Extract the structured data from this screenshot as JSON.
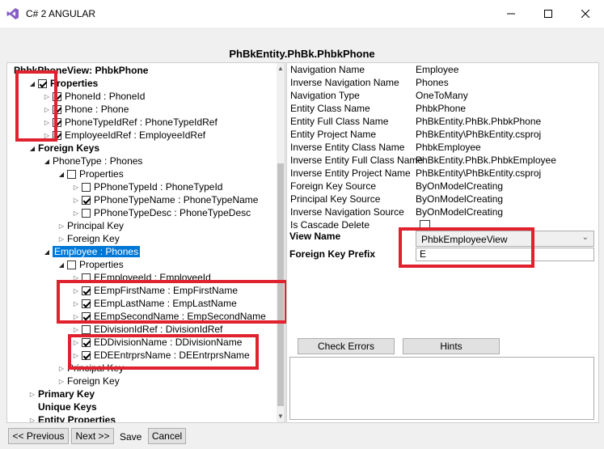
{
  "window": {
    "title": "C# 2 ANGULAR"
  },
  "header": {
    "title": "PhBkEntity.PhBk.PhbkPhone"
  },
  "tree": [
    {
      "label": "PhbkPhoneView: PhbkPhone",
      "bold": true,
      "arrow": "",
      "cb": "",
      "indent": 0
    },
    {
      "label": "Properties",
      "bold": true,
      "arrow": "down",
      "cb": "checked",
      "indent": 1
    },
    {
      "label": "PhoneId : PhoneId",
      "arrow": "right",
      "cb": "checked",
      "indent": 2
    },
    {
      "label": "Phone : Phone",
      "arrow": "right",
      "cb": "checked",
      "indent": 2
    },
    {
      "label": "PhoneTypeIdRef : PhoneTypeIdRef",
      "arrow": "right",
      "cb": "checked",
      "indent": 2
    },
    {
      "label": "EmployeeIdRef : EmployeeIdRef",
      "arrow": "right",
      "cb": "checked",
      "indent": 2
    },
    {
      "label": "Foreign Keys",
      "bold": true,
      "arrow": "down",
      "cb": "",
      "indent": 1
    },
    {
      "label": "PhoneType : Phones",
      "arrow": "down",
      "cb": "",
      "indent": 2
    },
    {
      "label": "Properties",
      "arrow": "down",
      "cb": "unchecked",
      "indent": 3
    },
    {
      "label": "PPhoneTypeId : PhoneTypeId",
      "arrow": "right",
      "cb": "unchecked",
      "indent": 4
    },
    {
      "label": "PPhoneTypeName : PhoneTypeName",
      "arrow": "right",
      "cb": "checked",
      "indent": 4
    },
    {
      "label": "PPhoneTypeDesc : PhoneTypeDesc",
      "arrow": "right",
      "cb": "unchecked",
      "indent": 4
    },
    {
      "label": "Principal Key",
      "arrow": "right",
      "cb": "",
      "indent": 3
    },
    {
      "label": "Foreign Key",
      "arrow": "right",
      "cb": "",
      "indent": 3
    },
    {
      "label": "Employee : Phones",
      "arrow": "down",
      "cb": "",
      "indent": 2,
      "selected": true
    },
    {
      "label": "Properties",
      "arrow": "down",
      "cb": "unchecked",
      "indent": 3
    },
    {
      "label": "EEmployeeId : EmployeeId",
      "arrow": "right",
      "cb": "unchecked",
      "indent": 4
    },
    {
      "label": "EEmpFirstName : EmpFirstName",
      "arrow": "right",
      "cb": "checked",
      "indent": 4
    },
    {
      "label": "EEmpLastName : EmpLastName",
      "arrow": "right",
      "cb": "checked",
      "indent": 4
    },
    {
      "label": "EEmpSecondName : EmpSecondName",
      "arrow": "right",
      "cb": "checked",
      "indent": 4
    },
    {
      "label": "EDivisionIdRef : DivisionIdRef",
      "arrow": "right",
      "cb": "unchecked",
      "indent": 4
    },
    {
      "label": "EDDivisionName : DDivisionName",
      "arrow": "right",
      "cb": "checked",
      "indent": 4
    },
    {
      "label": "EDEEntrprsName : DEEntrprsName",
      "arrow": "right",
      "cb": "checked",
      "indent": 4
    },
    {
      "label": "Principal Key",
      "arrow": "right",
      "cb": "",
      "indent": 3
    },
    {
      "label": "Foreign Key",
      "arrow": "right",
      "cb": "",
      "indent": 3
    },
    {
      "label": "Primary Key",
      "bold": true,
      "arrow": "right",
      "cb": "",
      "indent": 1
    },
    {
      "label": "Unique Keys",
      "bold": true,
      "arrow": "",
      "cb": "",
      "indent": 1
    },
    {
      "label": "Entity Properties",
      "bold": true,
      "arrow": "right",
      "cb": "",
      "indent": 1
    }
  ],
  "properties": [
    {
      "label": "Navigation Name",
      "value": "Employee"
    },
    {
      "label": "Inverse Navigation Name",
      "value": "Phones"
    },
    {
      "label": "Navigation Type",
      "value": "OneToMany"
    },
    {
      "label": "Entity Class Name",
      "value": "PhbkPhone"
    },
    {
      "label": "Entity Full Class Name",
      "value": "PhBkEntity.PhBk.PhbkPhone"
    },
    {
      "label": "Entity Project Name",
      "value": "PhBkEntity\\PhBkEntity.csproj"
    },
    {
      "label": "Inverse Entity Class Name",
      "value": "PhbkEmployee"
    },
    {
      "label": "Inverse Entity Full Class Name",
      "value": "PhBkEntity.PhBk.PhbkEmployee"
    },
    {
      "label": "Inverse Entity Project Name",
      "value": "PhBkEntity\\PhBkEntity.csproj"
    },
    {
      "label": "Foreign Key Source",
      "value": "ByOnModelCreating"
    },
    {
      "label": "Principal Key Source",
      "value": "ByOnModelCreating"
    },
    {
      "label": "Inverse Navigation Source",
      "value": "ByOnModelCreating"
    },
    {
      "label": "Is Cascade Delete",
      "value": ""
    }
  ],
  "view_name": {
    "label": "View Name",
    "value": "PhbkEmployeeView"
  },
  "fk_prefix": {
    "label": "Foreign Key Prefix",
    "value": "E"
  },
  "buttons": {
    "check_errors": "Check Errors",
    "hints": "Hints",
    "previous": "<< Previous",
    "next": "Next >>",
    "save": "Save",
    "cancel": "Cancel"
  },
  "colors": {
    "highlight": "#e0222f",
    "selection": "#0078d7"
  }
}
